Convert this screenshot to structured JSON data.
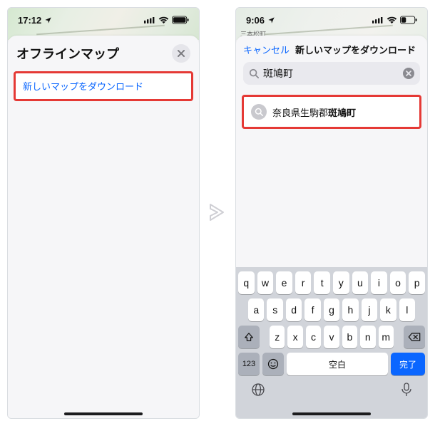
{
  "left": {
    "status_time": "17:12",
    "sheet_title": "オフラインマップ",
    "download_link": "新しいマップをダウンロード"
  },
  "right": {
    "status_time": "9:06",
    "map_label": "三本松町",
    "nav_cancel": "キャンセル",
    "nav_title": "新しいマップをダウンロード",
    "search_value": "斑鳩町",
    "result_prefix": "奈良県生駒郡",
    "result_match": "斑鳩町",
    "keyboard": {
      "row1": [
        "q",
        "w",
        "e",
        "r",
        "t",
        "y",
        "u",
        "i",
        "o",
        "p"
      ],
      "row2": [
        "a",
        "s",
        "d",
        "f",
        "g",
        "h",
        "j",
        "k",
        "l"
      ],
      "row3": [
        "z",
        "x",
        "c",
        "v",
        "b",
        "n",
        "m"
      ],
      "mode_key": "123",
      "space_key": "空白",
      "done_key": "完了"
    }
  }
}
